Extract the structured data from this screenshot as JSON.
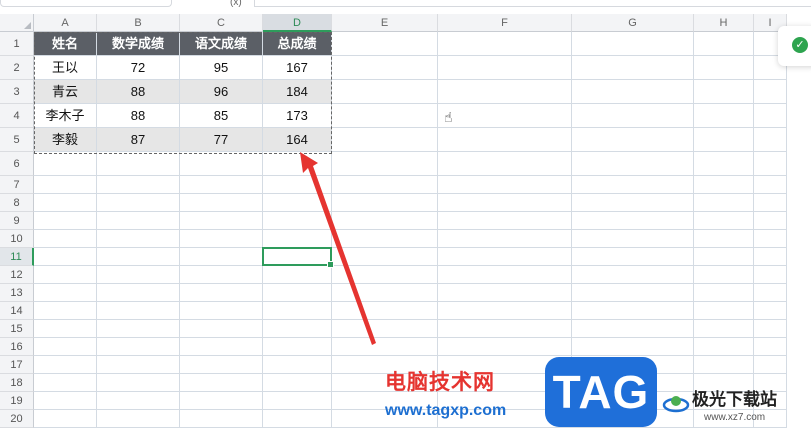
{
  "formula_bar": {
    "name_box_value": "",
    "fx_label": "(x)"
  },
  "columns": [
    "A",
    "B",
    "C",
    "D",
    "E",
    "F",
    "G",
    "H",
    "I"
  ],
  "rows": [
    "1",
    "2",
    "3",
    "4",
    "5",
    "6",
    "7",
    "8",
    "9",
    "10",
    "11",
    "12",
    "13",
    "14",
    "15",
    "16",
    "17",
    "18",
    "19",
    "20"
  ],
  "table": {
    "headers": [
      "姓名",
      "数学成绩",
      "语文成绩",
      "总成绩"
    ],
    "rows": [
      [
        "王以",
        "72",
        "95",
        "167"
      ],
      [
        "青云",
        "88",
        "96",
        "184"
      ],
      [
        "李木子",
        "88",
        "85",
        "173"
      ],
      [
        "李毅",
        "87",
        "77",
        "164"
      ]
    ]
  },
  "selection": {
    "column": "D",
    "row": "11"
  },
  "watermarks": {
    "site_name": "电脑技术网",
    "site_url": "www.tagxp.com",
    "tag_logo": "TAG",
    "xz_name": "极光下载站",
    "xz_url": "www.xz7.com"
  },
  "colors": {
    "header_bg": "#5b5f66",
    "shade_bg": "#e6e6e6",
    "selection": "#2e9c5c",
    "arrow": "#e53430"
  }
}
